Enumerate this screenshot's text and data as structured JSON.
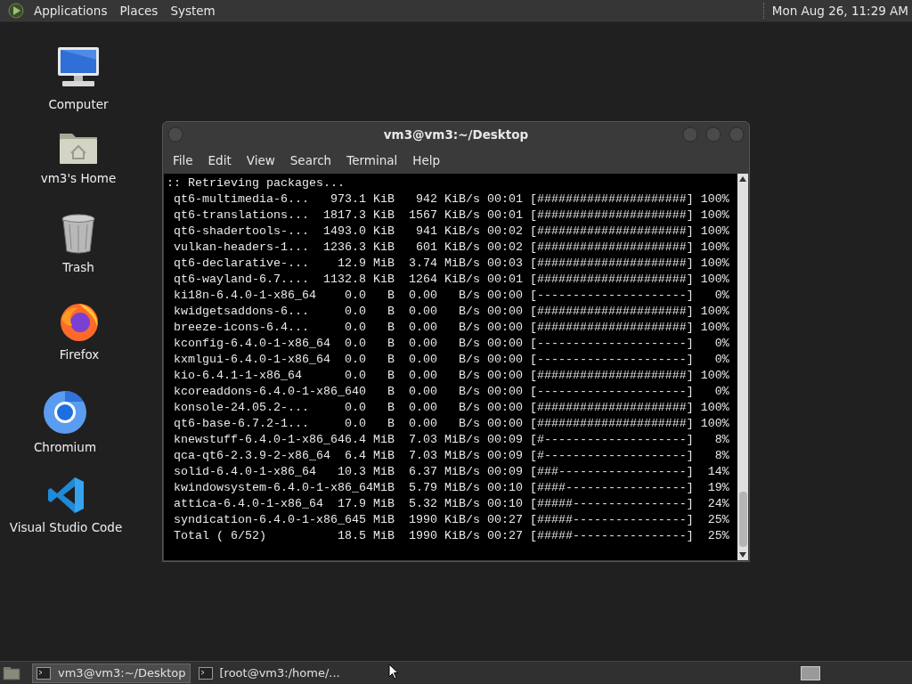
{
  "top_panel": {
    "menus": [
      "Applications",
      "Places",
      "System"
    ],
    "clock": "Mon Aug 26, 11:29 AM"
  },
  "desktop_icons": [
    {
      "kind": "computer",
      "label": "Computer"
    },
    {
      "kind": "home",
      "label": "vm3's Home"
    },
    {
      "kind": "trash",
      "label": "Trash"
    },
    {
      "kind": "firefox",
      "label": "Firefox"
    },
    {
      "kind": "chromium",
      "label": "Chromium"
    },
    {
      "kind": "vscode",
      "label": "Visual Studio Code"
    }
  ],
  "terminal_window": {
    "title": "vm3@vm3:~/Desktop",
    "menus": [
      "File",
      "Edit",
      "View",
      "Search",
      "Terminal",
      "Help"
    ],
    "lines": [
      ":: Retrieving packages...",
      " qt6-multimedia-6...   973.1 KiB   942 KiB/s 00:01 [#####################] 100%",
      " qt6-translations...  1817.3 KiB  1567 KiB/s 00:01 [#####################] 100%",
      " qt6-shadertools-...  1493.0 KiB   941 KiB/s 00:02 [#####################] 100%",
      " vulkan-headers-1...  1236.3 KiB   601 KiB/s 00:02 [#####################] 100%",
      " qt6-declarative-...    12.9 MiB  3.74 MiB/s 00:03 [#####################] 100%",
      " qt6-wayland-6.7....  1132.8 KiB  1264 KiB/s 00:01 [#####################] 100%",
      " ki18n-6.4.0-1-x86_64    0.0   B  0.00   B/s 00:00 [---------------------]   0%",
      " kwidgetsaddons-6...     0.0   B  0.00   B/s 00:00 [#####################] 100%",
      " breeze-icons-6.4...     0.0   B  0.00   B/s 00:00 [#####################] 100%",
      " kconfig-6.4.0-1-x86_64  0.0   B  0.00   B/s 00:00 [---------------------]   0%",
      " kxmlgui-6.4.0-1-x86_64  0.0   B  0.00   B/s 00:00 [---------------------]   0%",
      " kio-6.4.1-1-x86_64      0.0   B  0.00   B/s 00:00 [#####################] 100%",
      " kcoreaddons-6.4.0-1-x86_640   B  0.00   B/s 00:00 [---------------------]   0%",
      " konsole-24.05.2-...     0.0   B  0.00   B/s 00:00 [#####################] 100%",
      " qt6-base-6.7.2-1...     0.0   B  0.00   B/s 00:00 [#####################] 100%",
      " knewstuff-6.4.0-1-x86_646.4 MiB  7.03 MiB/s 00:09 [#--------------------]   8%",
      " qca-qt6-2.3.9-2-x86_64  6.4 MiB  7.03 MiB/s 00:09 [#--------------------]   8%",
      " solid-6.4.0-1-x86_64   10.3 MiB  6.37 MiB/s 00:09 [###------------------]  14%",
      " kwindowsystem-6.4.0-1-x86_64MiB  5.79 MiB/s 00:10 [####-----------------]  19%",
      " attica-6.4.0-1-x86_64  17.9 MiB  5.32 MiB/s 00:10 [#####----------------]  24%",
      " syndication-6.4.0-1-x86_645 MiB  1990 KiB/s 00:27 [#####----------------]  25%",
      " Total ( 6/52)          18.5 MiB  1990 KiB/s 00:27 [#####----------------]  25%"
    ]
  },
  "taskbar": {
    "items": [
      {
        "label": "vm3@vm3:~/Desktop",
        "selected": true
      },
      {
        "label": "[root@vm3:/home/...",
        "selected": false
      }
    ]
  }
}
